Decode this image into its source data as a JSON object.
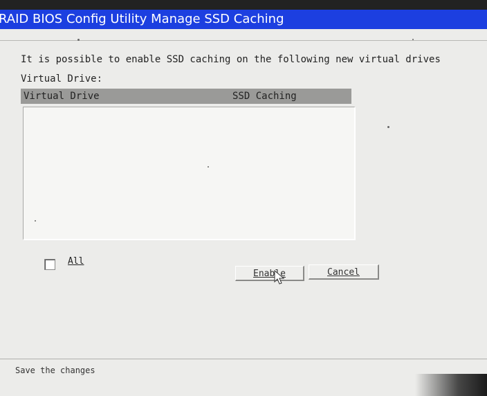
{
  "window": {
    "title": "RAID BIOS Config Utility Manage SSD Caching"
  },
  "main": {
    "description": "It is possible to enable SSD caching on the following new virtual drives",
    "virtual_drive_label": "Virtual Drive:",
    "table": {
      "columns": [
        "Virtual Drive",
        "SSD Caching"
      ],
      "rows": []
    }
  },
  "controls": {
    "all_checkbox_label": "All",
    "all_checked": false,
    "enable_label": "Enable",
    "cancel_label": "Cancel"
  },
  "status": {
    "text": "Save the changes"
  },
  "colors": {
    "titlebar": "#1c3fe0",
    "background": "#ececea",
    "list_header": "#9a9a98"
  }
}
